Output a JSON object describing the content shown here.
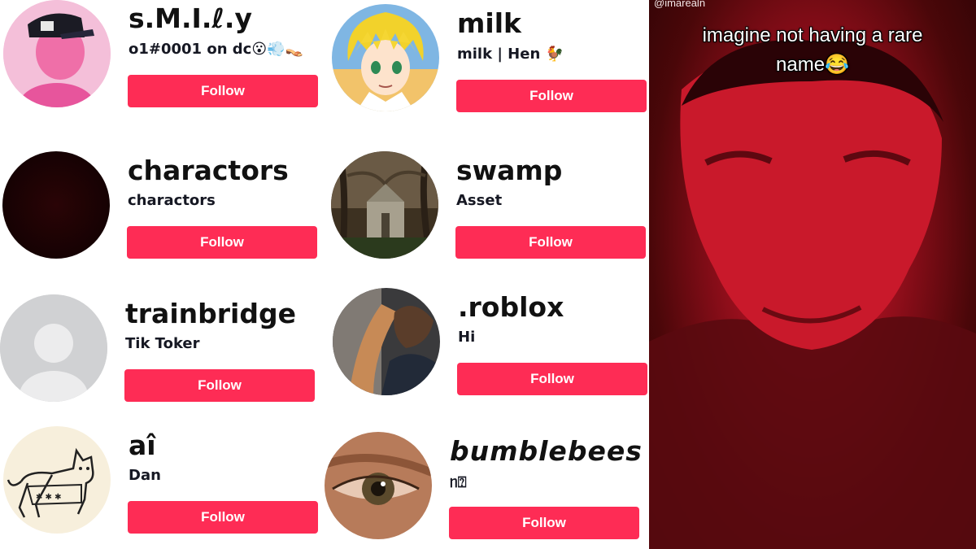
{
  "follow_label": "Follow",
  "colors": {
    "follow_button": "#fe2c55",
    "follow_text": "#ffffff",
    "username": "#111111"
  },
  "accounts": [
    {
      "username": "s.M.I.ℓ.y",
      "bio": "o1#0001 on dc😮💨👡",
      "avatar_icon": "avatar-pink-cap-icon"
    },
    {
      "username": "milk",
      "bio": "milk | Hen 🐓",
      "avatar_icon": "avatar-anime-boy-icon"
    },
    {
      "username": "charactors",
      "bio": "charactors",
      "avatar_icon": "avatar-dark-icon"
    },
    {
      "username": "swamp",
      "bio": "Asset",
      "avatar_icon": "avatar-swamp-church-icon"
    },
    {
      "username": "trainbridge",
      "bio": "Tik Toker",
      "avatar_icon": "default-avatar-icon"
    },
    {
      "username": ".roblox",
      "bio": "Hi",
      "avatar_icon": "avatar-photo-icon"
    },
    {
      "username": "aî",
      "bio": "Dan",
      "avatar_icon": "avatar-cat-drawing-icon"
    },
    {
      "username": "bumblebees",
      "bio": "ᥒ⍰",
      "avatar_icon": "avatar-eye-closeup-icon"
    }
  ],
  "video": {
    "watermark": "@imarealn",
    "caption_line1": "imagine not having a rare",
    "caption_line2": "name😂"
  }
}
